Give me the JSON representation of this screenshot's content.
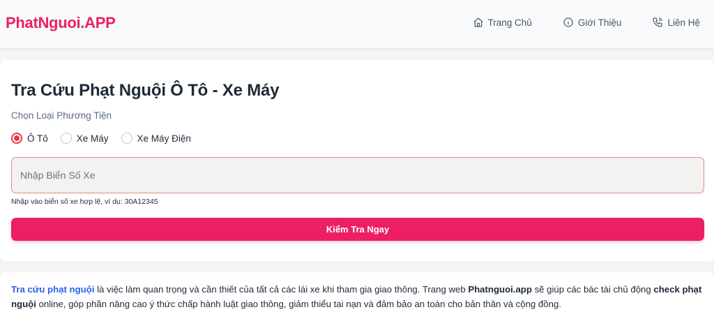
{
  "header": {
    "logo": "PhatNguoi.APP",
    "nav": [
      {
        "label": "Trang Chủ",
        "icon": "home-icon"
      },
      {
        "label": "Giới Thiệu",
        "icon": "info-icon"
      },
      {
        "label": "Liên Hệ",
        "icon": "phone-icon"
      }
    ]
  },
  "form": {
    "title": "Tra Cứu Phạt Nguội Ô Tô - Xe Máy",
    "vehicle_label": "Chọn Loại Phương Tiện",
    "options": [
      {
        "label": "Ô Tô",
        "checked": true
      },
      {
        "label": "Xe Máy",
        "checked": false
      },
      {
        "label": "Xe Máy Điện",
        "checked": false
      }
    ],
    "plate_placeholder": "Nhập Biển Số Xe",
    "plate_value": "",
    "hint": "Nhập vào biển số xe hợp lệ, ví dụ: 30A12345",
    "submit_label": "Kiểm Tra Ngay"
  },
  "info": {
    "link_text": "Tra cứu phạt nguội",
    "text_1": " là việc làm quan trọng và cần thiết của tất cả các lái xe khi tham gia giao thông. Trang web ",
    "brand": "Phatnguoi.app",
    "text_2": " sẽ giúp các bác tài chủ động ",
    "bold_2": "check phạt nguội",
    "text_3": " online, góp phần nâng cao ý thức chấp hành luật giao thông, giảm thiểu tai nạn và đảm bảo an toàn cho bản thân và cộng đồng."
  },
  "colors": {
    "brand": "#ec1f65",
    "link": "#2563eb",
    "radio_checked": "#e63946"
  }
}
